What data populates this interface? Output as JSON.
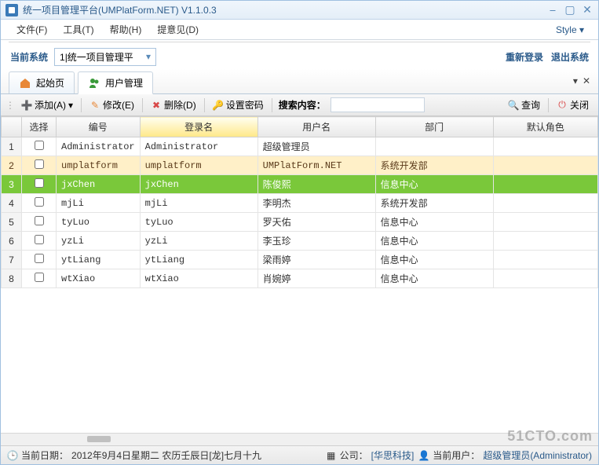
{
  "window": {
    "title": "统一项目管理平台(UMPlatForm.NET) V1.1.0.3"
  },
  "menu": {
    "file": "文件(F)",
    "tool": "工具(T)",
    "help": "帮助(H)",
    "feedback": "提意见(D)",
    "style": "Style ▾"
  },
  "sys": {
    "label": "当前系统",
    "value": "1|统一项目管理平",
    "relogin": "重新登录",
    "exit": "退出系统"
  },
  "tabs": {
    "home": "起始页",
    "user": "用户管理"
  },
  "toolbar": {
    "add": "添加(A)",
    "modify": "修改(E)",
    "delete": "删除(D)",
    "setpwd": "设置密码",
    "searchlabel": "搜索内容：",
    "query": "查询",
    "close": "关闭"
  },
  "columns": {
    "idx": "",
    "sel": "选择",
    "code": "编号",
    "login": "登录名",
    "uname": "用户名",
    "dept": "部门",
    "role": "默认角色"
  },
  "rows": [
    {
      "n": "1",
      "code": "Administrator",
      "login": "Administrator",
      "uname": "超级管理员",
      "dept": "",
      "cls": ""
    },
    {
      "n": "2",
      "code": "umplatform",
      "login": "umplatform",
      "uname": "UMPlatForm.NET",
      "dept": "系统开发部",
      "cls": "highlight"
    },
    {
      "n": "3",
      "code": "jxChen",
      "login": "jxChen",
      "uname": "陈俊熙",
      "dept": "信息中心",
      "cls": "selected"
    },
    {
      "n": "4",
      "code": "mjLi",
      "login": "mjLi",
      "uname": "李明杰",
      "dept": "系统开发部",
      "cls": ""
    },
    {
      "n": "5",
      "code": "tyLuo",
      "login": "tyLuo",
      "uname": "罗天佑",
      "dept": "信息中心",
      "cls": ""
    },
    {
      "n": "6",
      "code": "yzLi",
      "login": "yzLi",
      "uname": "李玉珍",
      "dept": "信息中心",
      "cls": ""
    },
    {
      "n": "7",
      "code": "ytLiang",
      "login": "ytLiang",
      "uname": "梁雨婷",
      "dept": "信息中心",
      "cls": ""
    },
    {
      "n": "8",
      "code": "wtXiao",
      "login": "wtXiao",
      "uname": "肖婉婷",
      "dept": "信息中心",
      "cls": ""
    }
  ],
  "status": {
    "date_label": "当前日期：",
    "date_value": "2012年9月4日星期二 农历壬辰日[龙]七月十九",
    "company_label": "公司：",
    "company_value": "[华思科技]",
    "user_label": "当前用户：",
    "user_value": "超级管理员(Administrator)"
  },
  "watermark": "51CTO.com"
}
